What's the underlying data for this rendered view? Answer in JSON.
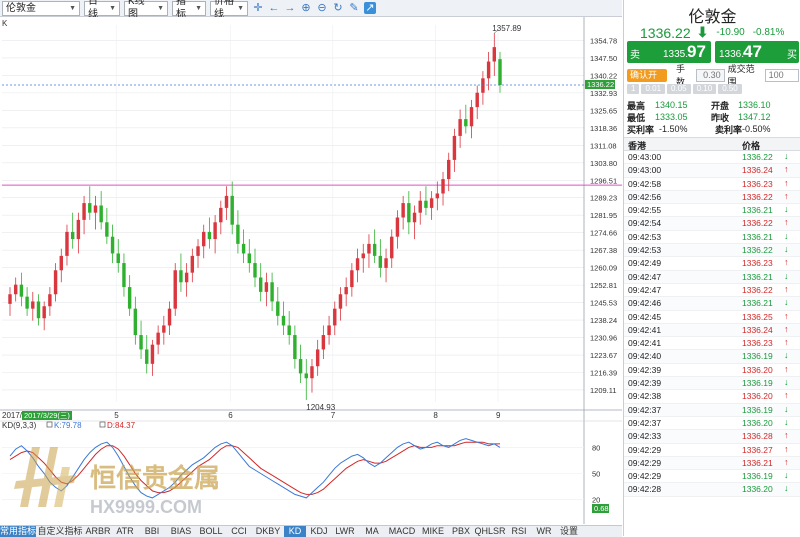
{
  "toolbar": {
    "symbol": "伦敦金",
    "period": "日线",
    "chart_type": "K线图",
    "indicator": "指标",
    "price_line": "价格线",
    "tools": [
      "crosshair-icon",
      "arrow-left-icon",
      "arrow-right-icon",
      "zoom-in-icon",
      "zoom-out-icon",
      "refresh-icon",
      "pen-icon",
      "share-icon"
    ]
  },
  "chart": {
    "corner_label": "K",
    "right_axis_ticks": [
      "1354.78",
      "1347.50",
      "1340.22",
      "1332.93",
      "1325.65",
      "1318.36",
      "1311.08",
      "1303.80",
      "1296.51",
      "1289.23",
      "1281.95",
      "1274.66",
      "1267.38",
      "1260.09",
      "1252.81",
      "1245.53",
      "1238.24",
      "1230.96",
      "1223.67",
      "1216.39",
      "1209.11"
    ],
    "current_price_tag": "1336.22",
    "high_label": "1357.89",
    "low_label": "1204.93",
    "date_ticks": [
      "5",
      "6",
      "7",
      "8",
      "9"
    ],
    "date_prefix": "2017/",
    "date_tooltip": "2017/3/29(三)",
    "horizontal_line_price": 1294.5,
    "colors": {
      "up": "#d9363e",
      "down": "#2fb12f",
      "hline": "#e052c6",
      "dash": "#3b78d6"
    }
  },
  "kd": {
    "label": "KD(9,3,3)",
    "k_label": "K:79.78",
    "d_label": "D:84.37",
    "ticks": [
      "80",
      "50",
      "20"
    ],
    "value_tag": "0.68"
  },
  "watermark": {
    "name": "恒信贵金属",
    "url": "HX9999.COM"
  },
  "bottom_tabs": [
    "常用指标",
    "自定义指标",
    "ARBR",
    "ATR",
    "BBI",
    "BIAS",
    "BOLL",
    "CCI",
    "DKBY",
    "KD",
    "KDJ",
    "LWR",
    "MA",
    "MACD",
    "MIKE",
    "PBX",
    "QHLSR",
    "RSI",
    "WR",
    "设置"
  ],
  "active_tab": "KD",
  "panel": {
    "title": "伦敦金",
    "price": "1336.22",
    "change": "-10.90",
    "change_pct": "-0.81%",
    "sell": {
      "label": "卖",
      "prefix": "1335.",
      "big": "97"
    },
    "buy": {
      "label": "买",
      "prefix": "1336.",
      "big": "47"
    },
    "confirm": "确认开仓",
    "lots_label": "手数",
    "lots_value": "0.30",
    "range_label": "成交范围",
    "range_value": "100",
    "chips": [
      "1",
      "0.01",
      "0.05",
      "0.10",
      "0.50"
    ],
    "stats": [
      {
        "l1": "最高",
        "v1": "1340.15",
        "l2": "开盘",
        "v2": "1336.10"
      },
      {
        "l1": "最低",
        "v1": "1333.05",
        "l2": "昨收",
        "v2": "1347.12"
      },
      {
        "l1": "买利率",
        "v1": "-1.50%",
        "l2": "卖利率",
        "v2": "-0.50%"
      }
    ],
    "table_headers": {
      "market": "香港",
      "price": "价格"
    },
    "trades": [
      {
        "t": "09:43:00",
        "p": "1336.22",
        "d": "down"
      },
      {
        "t": "09:43:00",
        "p": "1336.24",
        "d": "up"
      },
      {
        "t": "09:42:58",
        "p": "1336.23",
        "d": "up"
      },
      {
        "t": "09:42:56",
        "p": "1336.22",
        "d": "up"
      },
      {
        "t": "09:42:55",
        "p": "1336.21",
        "d": "down"
      },
      {
        "t": "09:42:54",
        "p": "1336.22",
        "d": "up"
      },
      {
        "t": "09:42:53",
        "p": "1336.21",
        "d": "down"
      },
      {
        "t": "09:42:53",
        "p": "1336.22",
        "d": "down"
      },
      {
        "t": "09:42:49",
        "p": "1336.23",
        "d": "up"
      },
      {
        "t": "09:42:47",
        "p": "1336.21",
        "d": "down"
      },
      {
        "t": "09:42:47",
        "p": "1336.22",
        "d": "up"
      },
      {
        "t": "09:42:46",
        "p": "1336.21",
        "d": "down"
      },
      {
        "t": "09:42:45",
        "p": "1336.25",
        "d": "up"
      },
      {
        "t": "09:42:41",
        "p": "1336.24",
        "d": "up"
      },
      {
        "t": "09:42:41",
        "p": "1336.23",
        "d": "up"
      },
      {
        "t": "09:42:40",
        "p": "1336.19",
        "d": "down"
      },
      {
        "t": "09:42:39",
        "p": "1336.20",
        "d": "up"
      },
      {
        "t": "09:42:39",
        "p": "1336.19",
        "d": "down"
      },
      {
        "t": "09:42:38",
        "p": "1336.20",
        "d": "up"
      },
      {
        "t": "09:42:37",
        "p": "1336.19",
        "d": "down"
      },
      {
        "t": "09:42:37",
        "p": "1336.20",
        "d": "down"
      },
      {
        "t": "09:42:33",
        "p": "1336.28",
        "d": "up"
      },
      {
        "t": "09:42:29",
        "p": "1336.27",
        "d": "up"
      },
      {
        "t": "09:42:29",
        "p": "1336.21",
        "d": "up"
      },
      {
        "t": "09:42:29",
        "p": "1336.19",
        "d": "down"
      },
      {
        "t": "09:42:28",
        "p": "1336.20",
        "d": "down"
      }
    ]
  },
  "chart_data": {
    "type": "candlestick",
    "x": [
      "5",
      "6",
      "7",
      "8",
      "9"
    ],
    "ylim": [
      1204.93,
      1357.89
    ],
    "candles": [
      [
        1245,
        1252,
        1240,
        1249
      ],
      [
        1249,
        1256,
        1246,
        1253
      ],
      [
        1253,
        1258,
        1244,
        1248
      ],
      [
        1248,
        1252,
        1240,
        1243
      ],
      [
        1243,
        1250,
        1238,
        1246
      ],
      [
        1246,
        1249,
        1236,
        1239
      ],
      [
        1239,
        1246,
        1234,
        1244
      ],
      [
        1244,
        1252,
        1240,
        1249
      ],
      [
        1249,
        1262,
        1246,
        1259
      ],
      [
        1259,
        1268,
        1254,
        1265
      ],
      [
        1265,
        1278,
        1261,
        1275
      ],
      [
        1275,
        1283,
        1268,
        1272
      ],
      [
        1272,
        1283,
        1266,
        1280
      ],
      [
        1280,
        1290,
        1274,
        1287
      ],
      [
        1287,
        1294,
        1280,
        1283
      ],
      [
        1283,
        1290,
        1276,
        1286
      ],
      [
        1286,
        1292,
        1276,
        1279
      ],
      [
        1279,
        1285,
        1270,
        1273
      ],
      [
        1273,
        1278,
        1262,
        1266
      ],
      [
        1266,
        1272,
        1258,
        1262
      ],
      [
        1262,
        1266,
        1248,
        1252
      ],
      [
        1252,
        1257,
        1240,
        1243
      ],
      [
        1243,
        1248,
        1228,
        1232
      ],
      [
        1232,
        1238,
        1222,
        1226
      ],
      [
        1226,
        1232,
        1216,
        1220
      ],
      [
        1220,
        1230,
        1215,
        1228
      ],
      [
        1228,
        1236,
        1224,
        1233
      ],
      [
        1233,
        1240,
        1228,
        1236
      ],
      [
        1236,
        1246,
        1232,
        1243
      ],
      [
        1243,
        1262,
        1240,
        1259
      ],
      [
        1259,
        1266,
        1250,
        1254
      ],
      [
        1254,
        1262,
        1248,
        1258
      ],
      [
        1258,
        1268,
        1254,
        1265
      ],
      [
        1265,
        1272,
        1260,
        1269
      ],
      [
        1269,
        1278,
        1264,
        1275
      ],
      [
        1275,
        1281,
        1268,
        1272
      ],
      [
        1272,
        1282,
        1266,
        1279
      ],
      [
        1279,
        1288,
        1274,
        1285
      ],
      [
        1285,
        1294,
        1280,
        1290
      ],
      [
        1290,
        1296,
        1274,
        1278
      ],
      [
        1278,
        1284,
        1266,
        1270
      ],
      [
        1270,
        1276,
        1262,
        1266
      ],
      [
        1266,
        1272,
        1258,
        1262
      ],
      [
        1262,
        1268,
        1252,
        1256
      ],
      [
        1256,
        1262,
        1246,
        1250
      ],
      [
        1250,
        1258,
        1244,
        1254
      ],
      [
        1254,
        1258,
        1242,
        1246
      ],
      [
        1246,
        1252,
        1236,
        1240
      ],
      [
        1240,
        1246,
        1232,
        1236
      ],
      [
        1236,
        1242,
        1228,
        1232
      ],
      [
        1232,
        1236,
        1218,
        1222
      ],
      [
        1222,
        1228,
        1212,
        1216
      ],
      [
        1216,
        1222,
        1204.93,
        1214
      ],
      [
        1214,
        1222,
        1208,
        1219
      ],
      [
        1219,
        1230,
        1215,
        1226
      ],
      [
        1226,
        1236,
        1222,
        1232
      ],
      [
        1232,
        1240,
        1228,
        1236
      ],
      [
        1236,
        1246,
        1232,
        1243
      ],
      [
        1243,
        1252,
        1238,
        1249
      ],
      [
        1249,
        1256,
        1244,
        1252
      ],
      [
        1252,
        1262,
        1248,
        1259
      ],
      [
        1259,
        1268,
        1254,
        1264
      ],
      [
        1264,
        1270,
        1258,
        1266
      ],
      [
        1266,
        1274,
        1260,
        1270
      ],
      [
        1270,
        1276,
        1262,
        1265
      ],
      [
        1265,
        1272,
        1256,
        1260
      ],
      [
        1260,
        1268,
        1254,
        1264
      ],
      [
        1264,
        1276,
        1260,
        1273
      ],
      [
        1273,
        1284,
        1268,
        1281
      ],
      [
        1281,
        1290,
        1276,
        1287
      ],
      [
        1287,
        1292,
        1274,
        1279
      ],
      [
        1279,
        1286,
        1272,
        1283
      ],
      [
        1283,
        1292,
        1278,
        1288
      ],
      [
        1288,
        1294,
        1282,
        1285
      ],
      [
        1285,
        1292,
        1280,
        1289
      ],
      [
        1289,
        1296,
        1284,
        1291
      ],
      [
        1291,
        1300,
        1286,
        1297
      ],
      [
        1297,
        1308,
        1292,
        1305
      ],
      [
        1305,
        1318,
        1300,
        1315
      ],
      [
        1315,
        1326,
        1310,
        1322
      ],
      [
        1322,
        1328,
        1316,
        1319
      ],
      [
        1319,
        1330,
        1314,
        1327
      ],
      [
        1327,
        1336,
        1322,
        1333
      ],
      [
        1333,
        1342,
        1328,
        1339
      ],
      [
        1339,
        1350,
        1334,
        1346
      ],
      [
        1346,
        1357.89,
        1340,
        1352
      ],
      [
        1347,
        1350,
        1333,
        1336.22
      ]
    ],
    "kd": {
      "k": [
        70,
        78,
        82,
        76,
        68,
        58,
        50,
        40,
        34,
        30,
        36,
        46,
        56,
        66,
        74,
        80,
        84,
        86,
        80,
        70,
        58,
        46,
        36,
        28,
        24,
        22,
        26,
        30,
        34,
        40,
        48,
        54,
        60,
        64,
        68,
        74,
        80,
        84,
        86,
        82,
        74,
        66,
        58,
        54,
        50,
        46,
        42,
        38,
        34,
        30,
        26,
        24,
        22,
        28,
        34,
        40,
        48,
        56,
        62,
        66,
        70,
        72,
        68,
        62,
        58,
        62,
        68,
        74,
        80,
        84,
        86,
        82,
        78,
        80,
        84,
        86,
        82,
        80,
        84,
        88,
        90,
        88,
        86,
        84,
        82,
        84,
        80
      ],
      "d": [
        66,
        70,
        74,
        76,
        74,
        68,
        62,
        54,
        46,
        40,
        38,
        42,
        48,
        56,
        64,
        72,
        78,
        82,
        82,
        78,
        70,
        60,
        50,
        42,
        36,
        30,
        28,
        28,
        30,
        34,
        40,
        46,
        52,
        58,
        62,
        66,
        72,
        78,
        82,
        82,
        80,
        74,
        68,
        62,
        56,
        52,
        48,
        44,
        40,
        36,
        32,
        28,
        26,
        26,
        28,
        32,
        38,
        44,
        50,
        56,
        60,
        64,
        66,
        64,
        62,
        62,
        64,
        68,
        72,
        76,
        80,
        82,
        80,
        80,
        80,
        82,
        82,
        82,
        82,
        84,
        86,
        86,
        86,
        86,
        84,
        84,
        84
      ]
    }
  }
}
